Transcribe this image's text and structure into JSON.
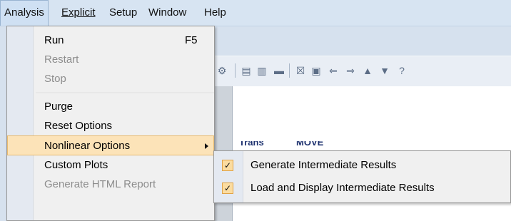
{
  "menubar": {
    "items": [
      {
        "label": "Analysis"
      },
      {
        "label": "Explicit"
      },
      {
        "label": "Setup"
      },
      {
        "label": "Window"
      },
      {
        "label": "Help"
      }
    ]
  },
  "toolbar": {
    "icons": [
      "probe-icon",
      "chart-icon",
      "chart-icon",
      "panel-icon",
      "box-icon",
      "export-icon",
      "arrow-left-icon",
      "arrow-right-icon",
      "triangle-icon",
      "triangle-icon",
      "help-icon"
    ]
  },
  "background": {
    "obscured_text_left": "Trans",
    "obscured_text_right": "MOVE"
  },
  "analysis_menu": {
    "items": [
      {
        "label": "Run",
        "shortcut": "F5",
        "enabled": true
      },
      {
        "label": "Restart",
        "enabled": false
      },
      {
        "label": "Stop",
        "enabled": false
      },
      {
        "label": "Purge",
        "enabled": true
      },
      {
        "label": "Reset Options",
        "enabled": true
      },
      {
        "label": "Nonlinear Options",
        "enabled": true,
        "highlighted": true,
        "has_submenu": true
      },
      {
        "label": "Custom Plots",
        "enabled": true
      },
      {
        "label": "Generate HTML Report",
        "enabled": false
      }
    ]
  },
  "nonlinear_submenu": {
    "items": [
      {
        "label": "Generate Intermediate Results",
        "checked": true
      },
      {
        "label": "Load and Display Intermediate Results",
        "checked": true
      }
    ]
  },
  "colors": {
    "menubar_bg": "#d7e4f2",
    "highlight_bg": "#fce3b8",
    "highlight_border": "#e8ba6f",
    "checkbox_bg": "#fbdca0",
    "menu_bg": "#f0f0f0"
  }
}
